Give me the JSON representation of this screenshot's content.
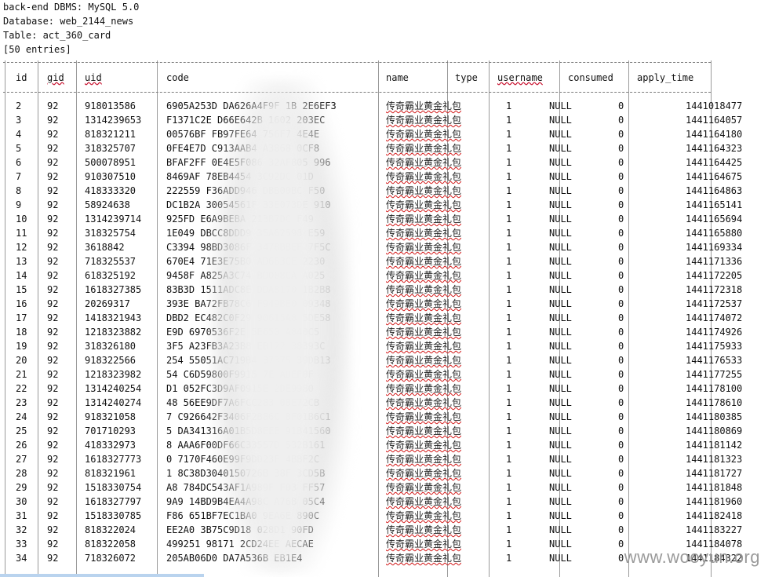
{
  "info": {
    "dbms": "back-end DBMS: MySQL 5.0",
    "database": "Database: web_2144_news",
    "table": "Table: act_360_card",
    "entries": "[50 entries]"
  },
  "table": {
    "columns": [
      "id",
      "gid",
      "uid",
      "code",
      "name",
      "type",
      "username",
      "consumed",
      "apply_time"
    ],
    "rows": [
      [
        "2",
        "92",
        "918013586",
        "6905A253D  DA626A4F9F   1B   2E6EF3",
        "传奇霸业黄金礼包",
        "1",
        "NULL",
        "0",
        "1441018477"
      ],
      [
        "3",
        "92",
        "1314239653",
        "F1371C2E   D66E642B   1602   203EC",
        "传奇霸业黄金礼包",
        "1",
        "NULL",
        "0",
        "1441164057"
      ],
      [
        "4",
        "92",
        "818321211",
        "00576BF   FB97FE64   756F7   4E4E",
        "传奇霸业黄金礼包",
        "1",
        "NULL",
        "0",
        "1441164180"
      ],
      [
        "5",
        "92",
        "318325707",
        "0FE4E7D   C913AAB4   A3868   0CF8",
        "传奇霸业黄金礼包",
        "1",
        "NULL",
        "0",
        "1441164323"
      ],
      [
        "6",
        "92",
        "500078951",
        "BFAF2FF   0E4E5F086   32AF805   996",
        "传奇霸业黄金礼包",
        "1",
        "NULL",
        "0",
        "1441164425"
      ],
      [
        "7",
        "92",
        "910307510",
        "8469AF   78EB4454   3C92DC   01D",
        "传奇霸业黄金礼包",
        "1",
        "NULL",
        "0",
        "1441164675"
      ],
      [
        "8",
        "92",
        "418333320",
        "222559   F36ADD946   DBB00BC   F50",
        "传奇霸业黄金礼包",
        "1",
        "NULL",
        "0",
        "1441164863"
      ],
      [
        "9",
        "92",
        "58924638",
        "DC1B2A   30054561F   33E073DE   910",
        "传奇霸业黄金礼包",
        "1",
        "NULL",
        "0",
        "1441165141"
      ],
      [
        "10",
        "92",
        "1314239714",
        "925FD   E6A9BEBA   213B7DC   F49",
        "传奇霸业黄金礼包",
        "1",
        "NULL",
        "0",
        "1441165694"
      ],
      [
        "11",
        "92",
        "318325754",
        "1E049   DBCC8DDD9   35A62598   E59",
        "传奇霸业黄金礼包",
        "1",
        "NULL",
        "0",
        "1441165880"
      ],
      [
        "12",
        "92",
        "3618842",
        "C3394   98BD3086F   3478BBEF   7F5C",
        "传奇霸业黄金礼包",
        "1",
        "NULL",
        "0",
        "1441169334"
      ],
      [
        "13",
        "92",
        "718325537",
        "670E4   71E3E75B0   AD663CE   2230",
        "传奇霸业黄金礼包",
        "1",
        "NULL",
        "0",
        "1441171336"
      ],
      [
        "14",
        "92",
        "618325192",
        "9458F   A825A3C74   BD008CA   A025",
        "传奇霸业黄金礼包",
        "1",
        "NULL",
        "0",
        "1441172205"
      ],
      [
        "15",
        "92",
        "1618327385",
        "83B3D   1511ADC8E   DDA8170   1B2B8",
        "传奇霸业黄金礼包",
        "1",
        "NULL",
        "0",
        "1441172318"
      ],
      [
        "16",
        "92",
        "20269317",
        "393E   BA72FB78C6   F949BE0   09348",
        "传奇霸业黄金礼包",
        "1",
        "NULL",
        "0",
        "1441172537"
      ],
      [
        "17",
        "92",
        "1418321943",
        "DBD2   EC482C0F29   90615A8   5DE58",
        "传奇霸业黄金礼包",
        "1",
        "NULL",
        "0",
        "1441174072"
      ],
      [
        "18",
        "92",
        "1218323882",
        "E9D   6970536F2E   5E650   A840C5",
        "传奇霸业黄金礼包",
        "1",
        "NULL",
        "0",
        "1441174926"
      ],
      [
        "19",
        "92",
        "318326180",
        "3F5   A23FB3A23B8   EB122   38393C",
        "传奇霸业黄金礼包",
        "1",
        "NULL",
        "0",
        "1441175933"
      ],
      [
        "20",
        "92",
        "918322566",
        "254   55051AC719B4   37375   39DB13",
        "传奇霸业黄金礼包",
        "1",
        "NULL",
        "0",
        "1441176533"
      ],
      [
        "21",
        "92",
        "1218323982",
        "54   C6D59800F9915   7E   ADEF8F",
        "传奇霸业黄金礼包",
        "1",
        "NULL",
        "0",
        "1441177255"
      ],
      [
        "22",
        "92",
        "1314240254",
        "D1   052FC3D9AF0915E   2DE9980",
        "传奇霸业黄金礼包",
        "1",
        "NULL",
        "0",
        "1441178100"
      ],
      [
        "23",
        "92",
        "1314240274",
        "48   56EE9DF7A6FCC283   08E72CB",
        "传奇霸业黄金礼包",
        "1",
        "NULL",
        "0",
        "1441178610"
      ],
      [
        "24",
        "92",
        "918321058",
        "7   C926642F3406F2B86C   8F01B6C1",
        "传奇霸业黄金礼包",
        "1",
        "NULL",
        "0",
        "1441180385"
      ],
      [
        "25",
        "92",
        "701710293",
        "5   DA341316A01B5D8EEE   91B41560",
        "传奇霸业黄金礼包",
        "1",
        "NULL",
        "0",
        "1441180869"
      ],
      [
        "26",
        "92",
        "418332973",
        "8   AAA6F00DF66C33557D   532B161",
        "传奇霸业黄金礼包",
        "1",
        "NULL",
        "0",
        "1441181142"
      ],
      [
        "27",
        "92",
        "1618327773",
        "0   7170F460E99F9DD23F   4BBF2C",
        "传奇霸业黄金礼包",
        "1",
        "NULL",
        "0",
        "1441181323"
      ],
      [
        "28",
        "92",
        "818321961",
        "1   8C38D3040150726B   38F   3CD5B",
        "传奇霸业黄金礼包",
        "1",
        "NULL",
        "0",
        "1441181727"
      ],
      [
        "29",
        "92",
        "1518330754",
        "A8   784DC543AF1A989F   F03   FF57",
        "传奇霸业黄金礼包",
        "1",
        "NULL",
        "0",
        "1441181848"
      ],
      [
        "30",
        "92",
        "1618327797",
        "9A9   14BD9B4EA4A98C   A76B   05C4",
        "传奇霸业黄金礼包",
        "1",
        "NULL",
        "0",
        "1441181960"
      ],
      [
        "31",
        "92",
        "1518330785",
        "F86   651BF7EC1BA0   9EA6E   890C",
        "传奇霸业黄金礼包",
        "1",
        "NULL",
        "0",
        "1441182418"
      ],
      [
        "32",
        "92",
        "818322024",
        "EE2A0   3B75C9D18   028D1   90FD",
        "传奇霸业黄金礼包",
        "1",
        "NULL",
        "0",
        "1441183227"
      ],
      [
        "33",
        "92",
        "818322058",
        "499251   98171   2CD24EE   AECAE",
        "传奇霸业黄金礼包",
        "1",
        "NULL",
        "0",
        "1441184078"
      ],
      [
        "34",
        "92",
        "718326072",
        "205AB06D0   DA7A536B   EB1E4",
        "传奇霸业黄金礼包",
        "1",
        "NULL",
        "0",
        "1441184322"
      ]
    ]
  },
  "watermark": "www.wooyun.org"
}
